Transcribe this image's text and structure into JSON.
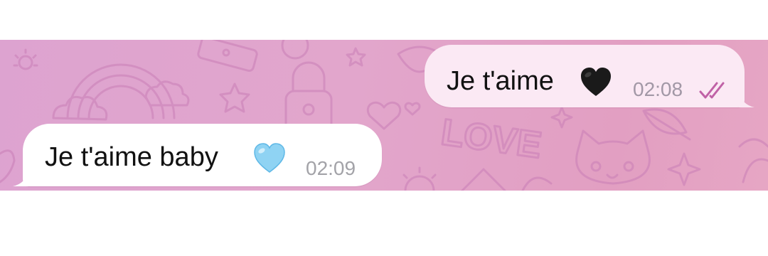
{
  "chat": {
    "messages": [
      {
        "direction": "outgoing",
        "text": "Je t'aime",
        "emoji": "black-heart-icon",
        "time": "02:08",
        "status": "read",
        "status_icon": "double-check-icon"
      },
      {
        "direction": "incoming",
        "text": "Je t'aime baby",
        "emoji": "light-blue-heart-icon",
        "time": "02:09"
      }
    ]
  },
  "colors": {
    "outgoing_bubble": "#fbe9f4",
    "incoming_bubble": "#ffffff",
    "read_ticks": "#c061a6",
    "wallpaper_start": "#dda3d0",
    "wallpaper_end": "#e6a6c4",
    "heart_black": "#1a1a1a",
    "heart_light_blue": "#8fd3f3"
  },
  "wallpaper": {
    "pattern_icons": [
      "rainbow-icon",
      "cloud-icon",
      "star-icon",
      "phone-icon",
      "lips-icon",
      "padlock-icon",
      "heart-icon",
      "love-text-icon",
      "cat-face-icon",
      "feather-icon",
      "sparkle-icon",
      "sun-icon"
    ]
  }
}
